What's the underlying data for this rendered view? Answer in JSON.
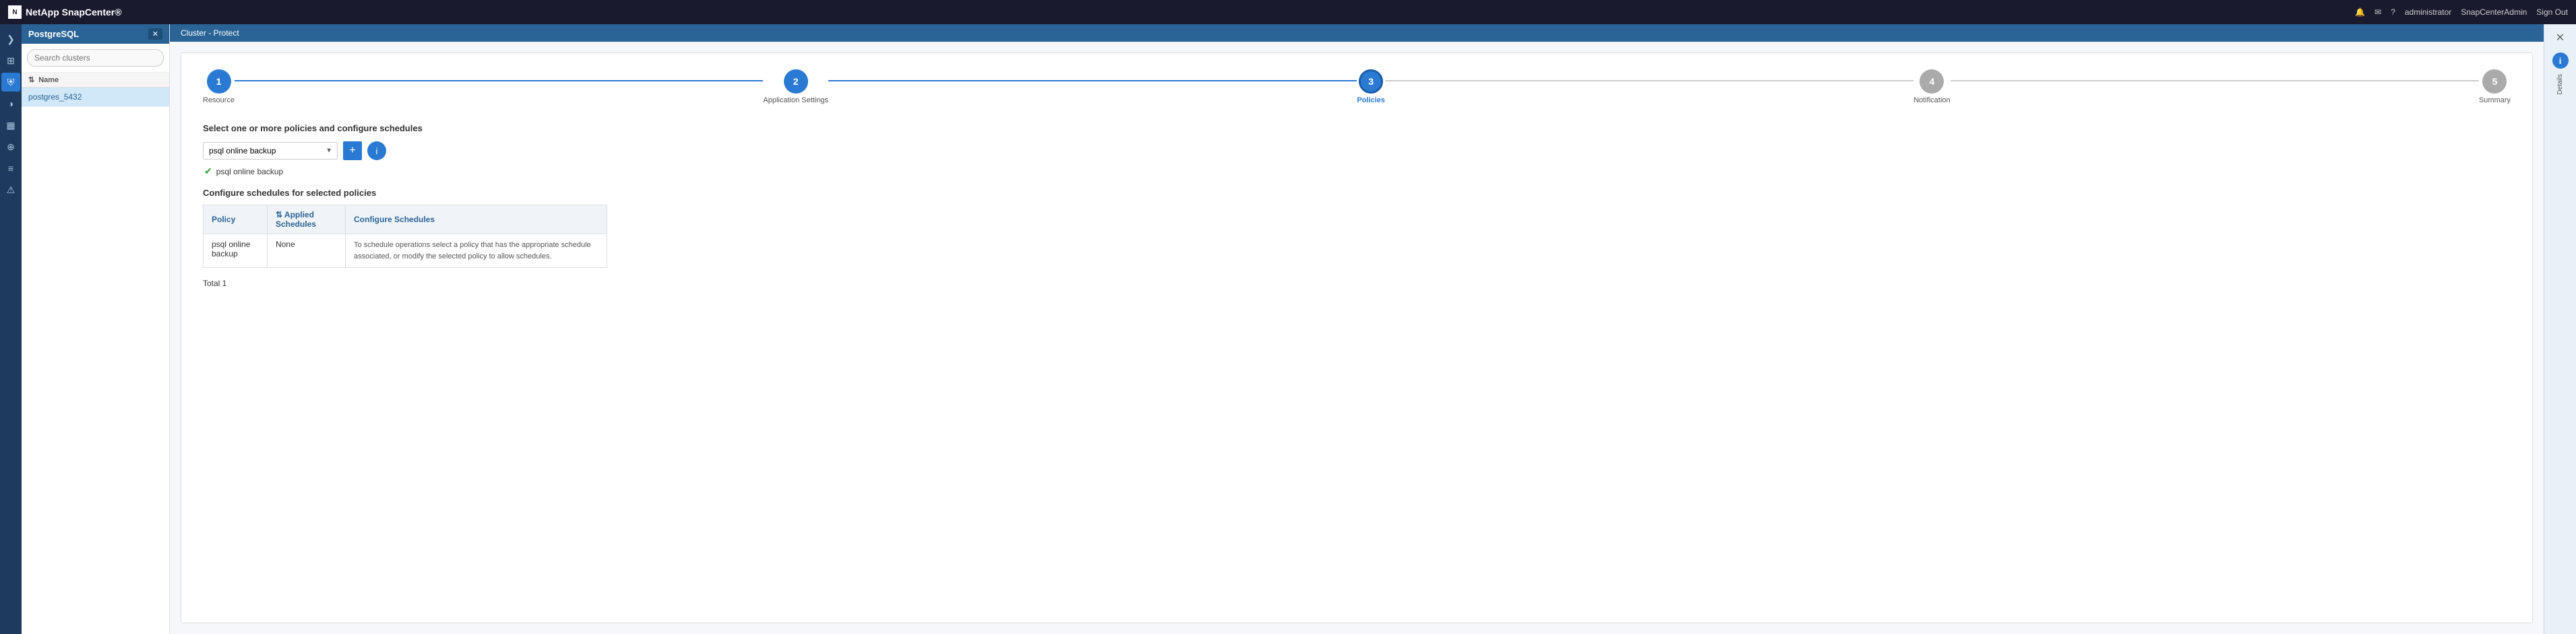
{
  "topNav": {
    "brand": "NetApp SnapCenter®",
    "logoText": "N",
    "icons": [
      "bell-icon",
      "mail-icon",
      "help-icon"
    ],
    "user": "administrator",
    "instance": "SnapCenterAdmin",
    "signout": "Sign Out"
  },
  "iconSidebar": {
    "icons": [
      {
        "name": "expand-icon",
        "symbol": "❯",
        "active": false
      },
      {
        "name": "grid-icon",
        "symbol": "⊞",
        "active": false
      },
      {
        "name": "protection-icon",
        "symbol": "⛨",
        "active": true
      },
      {
        "name": "reports-icon",
        "symbol": "◑",
        "active": false
      },
      {
        "name": "chart-icon",
        "symbol": "▦",
        "active": false
      },
      {
        "name": "topology-icon",
        "symbol": "⊕",
        "active": false
      },
      {
        "name": "list-icon",
        "symbol": "≡",
        "active": false
      },
      {
        "name": "alert-icon",
        "symbol": "⚠",
        "active": false
      }
    ]
  },
  "leftPanel": {
    "dbLabel": "PostgreSQL",
    "dbBtnLabel": "✕",
    "searchPlaceholder": "Search clusters",
    "tableHeader": "Name",
    "clusterItem": "postgres_5432"
  },
  "breadcrumb": "Cluster - Protect",
  "wizard": {
    "steps": [
      {
        "number": "1",
        "label": "Resource",
        "state": "completed"
      },
      {
        "number": "2",
        "label": "Application Settings",
        "state": "completed"
      },
      {
        "number": "3",
        "label": "Policies",
        "state": "active"
      },
      {
        "number": "4",
        "label": "Notification",
        "state": "inactive"
      },
      {
        "number": "5",
        "label": "Summary",
        "state": "inactive"
      }
    ],
    "sectionTitle": "Select one or more policies and configure schedules",
    "policyDropdownValue": "psql online backup",
    "policyDropdownOptions": [
      "psql online backup"
    ],
    "addBtnLabel": "+",
    "infoBtnLabel": "i",
    "selectedPolicyLabel": "psql online backup",
    "configureTitle": "Configure schedules for selected policies",
    "tableHeaders": {
      "policy": "Policy",
      "appliedSchedules": "Applied Schedules",
      "configureSchedules": "Configure Schedules"
    },
    "tableRows": [
      {
        "policy": "psql online backup",
        "appliedSchedules": "None",
        "configureSchedules": "To schedule operations select a policy that has the appropriate schedule associated, or modify the selected policy to allow schedules."
      }
    ],
    "totalLabel": "Total 1"
  },
  "rightPanel": {
    "closeBtn": "✕",
    "detailsLabel": "Details",
    "infoSymbol": "i"
  }
}
